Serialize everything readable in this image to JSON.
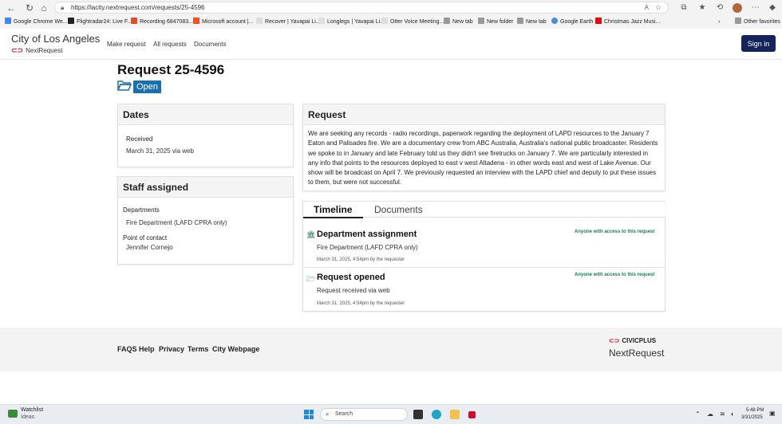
{
  "browser": {
    "url": "https://lacity.nextrequest.com/requests/25-4596",
    "bookmarks": [
      "Google Chrome We...",
      "Flightradar24: Live F...",
      "Recording 6847083...",
      "Microsoft account |...",
      "Recover | Yavapai Li...",
      "Longlegs | Yavapai Li...",
      "Otter Voice Meeting...",
      "New tab",
      "New folder",
      "New tab",
      "Google Earth",
      "Christmas Jazz Musi..."
    ],
    "other_favorites": "Other favorites"
  },
  "header": {
    "city_name": "City of Los Angeles",
    "logo_text": "NextRequest",
    "nav": [
      "Make request",
      "All requests",
      "Documents"
    ],
    "sign_in": "Sign in"
  },
  "request": {
    "title": "Request 25-4596",
    "status": "Open",
    "dates_heading": "Dates",
    "received_label": "Received",
    "received_value": "March 31, 2025 via web",
    "staff_heading": "Staff assigned",
    "departments_label": "Departments",
    "departments_value": "Fire Department (LAFD CPRA only)",
    "poc_label": "Point of contact",
    "poc_value": "Jennifer Cornejo",
    "request_heading": "Request",
    "request_text": "We are seeking any records - radio recordings, paperwork regarding the deployment of LAPD resources to the January 7 Eaton and Palisades fire. We are a documentary crew from ABC Australia, Australia's national public broadcaster. Residents we spoke to in January and late February told us they didn't see firetrucks on January 7. We are particularly interested in any info that points to the resources deployed to east v west Altadena - in other words east and west of Lake Avenue. Our show will be broadcast on April 7. We previously requested an interview with the LAPD chief and deputy to put these issues to them, but were not successful."
  },
  "timeline": {
    "tabs": [
      "Timeline",
      "Documents"
    ],
    "items": [
      {
        "title": "Department assignment",
        "detail": "Fire Department (LAFD CPRA only)",
        "meta": "March 31, 2025, 4:54pm by the requester",
        "visibility": "Anyone with access to this request",
        "icon": "building-icon"
      },
      {
        "title": "Request opened",
        "detail": "Request received via web",
        "meta": "March 31, 2025, 4:54pm by the requester",
        "visibility": "Anyone with access to this request",
        "icon": "folder-open-icon"
      }
    ]
  },
  "footer": {
    "links": [
      "FAQS",
      "Help",
      "Privacy",
      "Terms",
      "City Webpage"
    ],
    "brand_top": "CIVICPLUS",
    "brand_bottom": "NextRequest"
  },
  "taskbar": {
    "widget_title": "Watchlist",
    "widget_sub": "Ideas",
    "search_placeholder": "Search",
    "time": "5:48 PM",
    "date": "3/31/2025"
  },
  "colors": {
    "accent_navy": "#14235a",
    "status_blue": "#1a6fb0",
    "green": "#1d7a55",
    "brand_red": "#c8102e"
  }
}
